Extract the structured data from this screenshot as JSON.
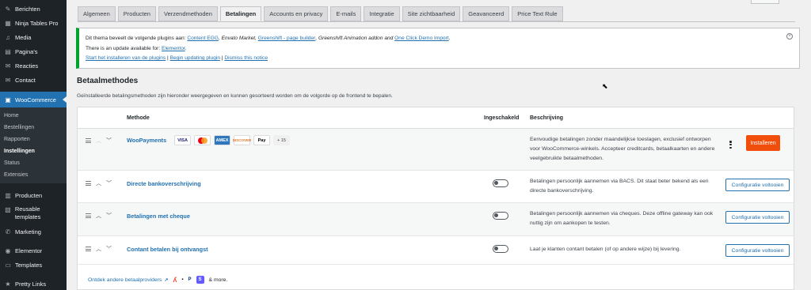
{
  "sidebar": {
    "items": [
      {
        "label": "Berichten",
        "icon": "pin-icon"
      },
      {
        "label": "Ninja Tables Pro",
        "icon": "table-icon"
      },
      {
        "label": "Media",
        "icon": "media-icon"
      },
      {
        "label": "Pagina's",
        "icon": "page-icon"
      },
      {
        "label": "Reacties",
        "icon": "comment-icon"
      },
      {
        "label": "Contact",
        "icon": "mail-icon"
      }
    ],
    "active": {
      "label": "WooCommerce",
      "icon": "woo-icon"
    },
    "sub": [
      "Home",
      "Bestellingen",
      "Rapporten",
      "Instellingen",
      "Status",
      "Extensies"
    ],
    "items2": [
      {
        "label": "Producten",
        "icon": "box-icon"
      },
      {
        "label": "Reusable templates",
        "icon": "template-icon"
      },
      {
        "label": "Marketing",
        "icon": "megaphone-icon"
      }
    ],
    "items3": [
      {
        "label": "Elementor",
        "icon": "elementor-icon"
      },
      {
        "label": "Templates",
        "icon": "folder-icon"
      }
    ],
    "items4": [
      {
        "label": "Pretty Links",
        "icon": "star-icon"
      }
    ]
  },
  "tabs": [
    "Algemeen",
    "Producten",
    "Verzendmethoden",
    "Betalingen",
    "Accounts en privacy",
    "E-mails",
    "Integratie",
    "Site zichtbaarheid",
    "Geavanceerd",
    "Price Text Rule"
  ],
  "notice": {
    "line1_prefix": "Dit thema beveelt de volgende plugins aan: ",
    "plugin1": "Content EGG",
    "sep1": ", Envato Market, ",
    "plugin2": "Greenshift - page builder",
    "sep2": ", Greenshift Animation addon and ",
    "plugin3": "One Click Demo Import",
    "end1": ".",
    "line2_prefix": "There is an update available for: ",
    "plugin4": "Elementor",
    "end2": ".",
    "link1": "Start het installeren van de plugins",
    "link2": "Begin updating plugin",
    "link3": "Dismiss this notice",
    "bar": " | "
  },
  "section": {
    "title": "Betaalmethodes",
    "description": "Geïnstalleerde betalingsmethoden zijn hieronder weergegeven en kunnen gesorteerd worden om de volgorde op de frontend te bepalen."
  },
  "table": {
    "headers": {
      "method": "Methode",
      "enabled": "Ingeschakeld",
      "description": "Beschrijving"
    },
    "woo": {
      "name": "WooPayments",
      "cards": [
        "VISA",
        "AMEX",
        "DISCOVER",
        "Pay"
      ],
      "more": "+ 15",
      "description": "Eenvoudige betalingen zonder maandelijkse toeslagen, exclusief ontworpen voor WooCommerce-winkels. Accepteer creditcards, betaalkaarten en andere veelgebruikte betaalmethoden.",
      "install": "Installeren"
    },
    "rows": [
      {
        "name": "Directe bankoverschrijving",
        "description": "Betalingen persoonlijk aannemen via BACS. Dit staat beter bekend als een directe bankoverschrijving.",
        "button": "Configuratie voltooien"
      },
      {
        "name": "Betalingen met cheque",
        "description": "Betalingen persoonlijk aannemen via cheques. Deze offline gateway kan ook nuttig zijn om aankopen te testen.",
        "button": "Configuratie voltooien"
      },
      {
        "name": "Contant betalen bij ontvangst",
        "description": "Laat je klanten contant betalen (of op andere wijze) bij levering.",
        "button": "Configuratie voltooien"
      }
    ],
    "footer": {
      "link": "Ontdek andere betaalproviders",
      "more": "& more.",
      "provider_icons": [
        "affirm-icon",
        "mollie-icon",
        "paypal-icon",
        "stripe-icon"
      ]
    }
  },
  "colors": {
    "accent": "#2271b1",
    "install": "#f24e0b",
    "notice_border": "#00a32a"
  }
}
